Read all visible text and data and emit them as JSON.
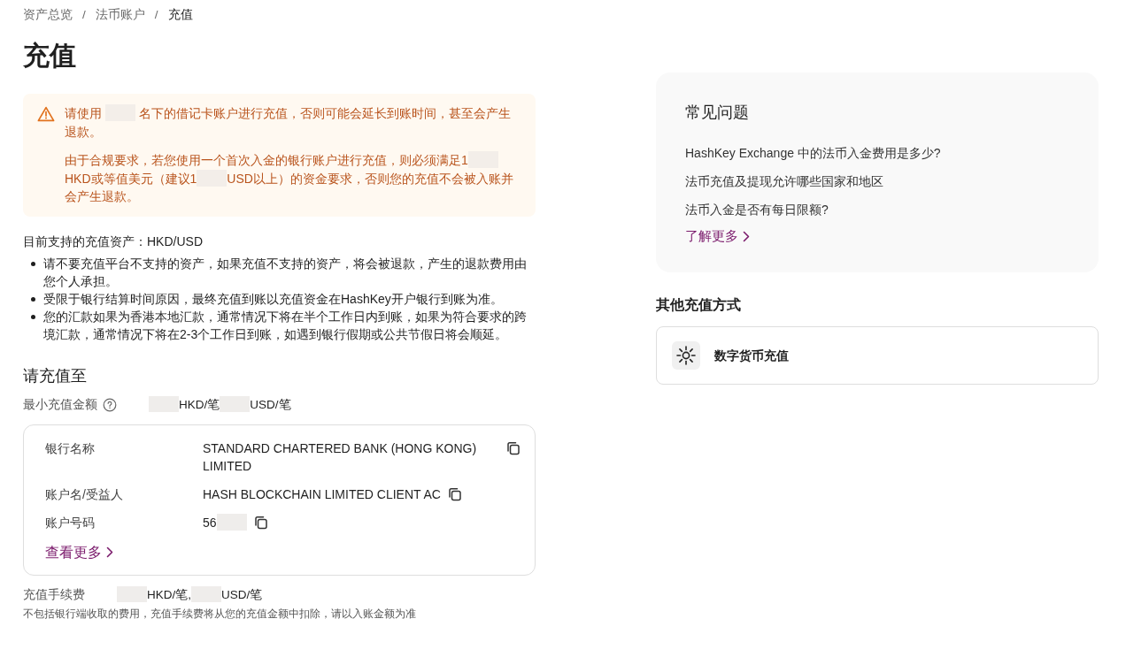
{
  "breadcrumb": {
    "separator": "/",
    "items": [
      {
        "label": "资产总览",
        "selected": false
      },
      {
        "label": "法币账户",
        "selected": false
      },
      {
        "label": "充值",
        "selected": true
      }
    ]
  },
  "page_title": "充值",
  "warning": {
    "paragraphs": [
      {
        "segments": [
          {
            "kind": "text",
            "text": "请使用 "
          },
          {
            "kind": "hidden"
          },
          {
            "kind": "text",
            "text": " 名下的借记卡账户进行充值，否则可能会延长到账时间，甚至会产生退款。"
          }
        ]
      },
      {
        "segments": [
          {
            "kind": "text",
            "text": "由于合规要求，若您使用一个首次入金的银行账户进行充值，则必须满足1"
          },
          {
            "kind": "hidden"
          },
          {
            "kind": "text",
            "text": "HKD或等值美元（建议1"
          },
          {
            "kind": "hidden"
          },
          {
            "kind": "text",
            "text": "USD以上）的资金要求，否则您的充值不会被入账并会产生退款。"
          }
        ]
      }
    ]
  },
  "supported_assets": "目前支持的充值资产：HKD/USD",
  "notes": [
    "请不要充值平台不支持的资产，如果充值不支持的资产，将会被退款，产生的退款费用由您个人承担。",
    "受限于银行结算时间原因，最终充值到账以充值资金在HashKey开户银行到账为准。",
    "您的汇款如果为香港本地汇款，通常情况下将在半个工作日内到账，如果为符合要求的跨境汇款，通常情况下将在2-3个工作日到账，如遇到银行假期或公共节假日将会顺延。"
  ],
  "deposit_to": {
    "heading": "请充值至",
    "min_amount": {
      "label": "最小充值金额",
      "segments": [
        {
          "kind": "hidden"
        },
        {
          "kind": "text",
          "text": "HKD/笔"
        },
        {
          "kind": "hidden"
        },
        {
          "kind": "text",
          "text": "USD/笔"
        }
      ]
    },
    "bank": {
      "rows": [
        {
          "label": "银行名称",
          "segments": [
            {
              "kind": "text",
              "text": "STANDARD CHARTERED BANK (HONG KONG) LIMITED"
            }
          ]
        },
        {
          "label": "账户名/受益人",
          "segments": [
            {
              "kind": "text",
              "text": "HASH BLOCKCHAIN LIMITED CLIENT AC"
            }
          ]
        },
        {
          "label": "账户号码",
          "segments": [
            {
              "kind": "text",
              "text": "56"
            },
            {
              "kind": "hidden"
            }
          ]
        }
      ],
      "more_link": "查看更多"
    },
    "fee": {
      "label": "充值手续费",
      "segments": [
        {
          "kind": "hidden"
        },
        {
          "kind": "text",
          "text": "HKD/笔,"
        },
        {
          "kind": "hidden"
        },
        {
          "kind": "text",
          "text": "USD/笔"
        }
      ]
    },
    "fee_note": "不包括银行端收取的费用，充值手续费将从您的充值金额中扣除，请以入账金额为准"
  },
  "faq": {
    "title": "常见问题",
    "questions": [
      "HashKey Exchange 中的法币入金费用是多少?",
      "法币充值及提现允许哪些国家和地区",
      "法币入金是否有每日限额?"
    ],
    "more_link": "了解更多"
  },
  "other_methods": {
    "heading": "其他充值方式",
    "items": [
      {
        "label": "数字货币充值"
      }
    ]
  }
}
